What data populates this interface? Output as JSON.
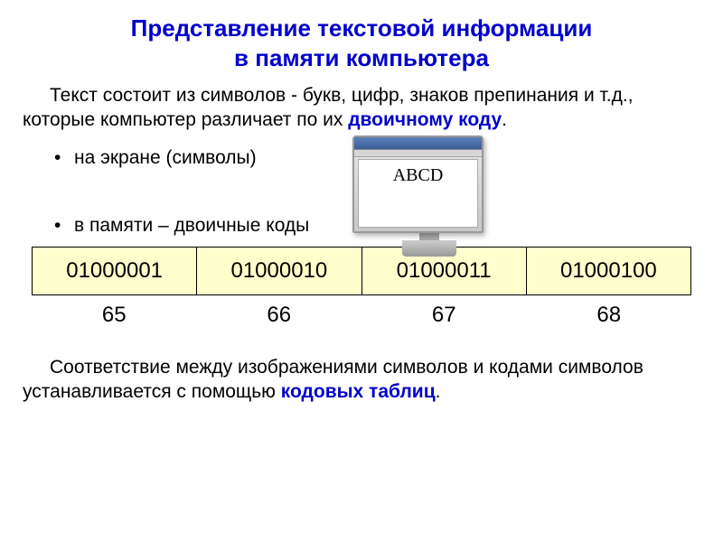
{
  "title_line1": "Представление текстовой информации",
  "title_line2": "в памяти компьютера",
  "intro_part1": "Текст состоит из символов - букв, цифр, знаков препинания и  т.д.,  которые компьютер различает по их ",
  "intro_highlight": "двоичному коду",
  "intro_part2": ".",
  "bullet1": "на экране (символы)",
  "bullet2": "в памяти – двоичные коды",
  "monitor_text": "ABCD",
  "binary": {
    "c0": "01000001",
    "c1": "01000010",
    "c2": "01000011",
    "c3": "01000100"
  },
  "decimal": {
    "c0": "65",
    "c1": "66",
    "c2": "67",
    "c3": "68"
  },
  "outro_part1": "Соответствие между изображениями символов и кодами символов устанавливается с помощью ",
  "outro_highlight": "кодовых таблиц",
  "outro_part2": "."
}
